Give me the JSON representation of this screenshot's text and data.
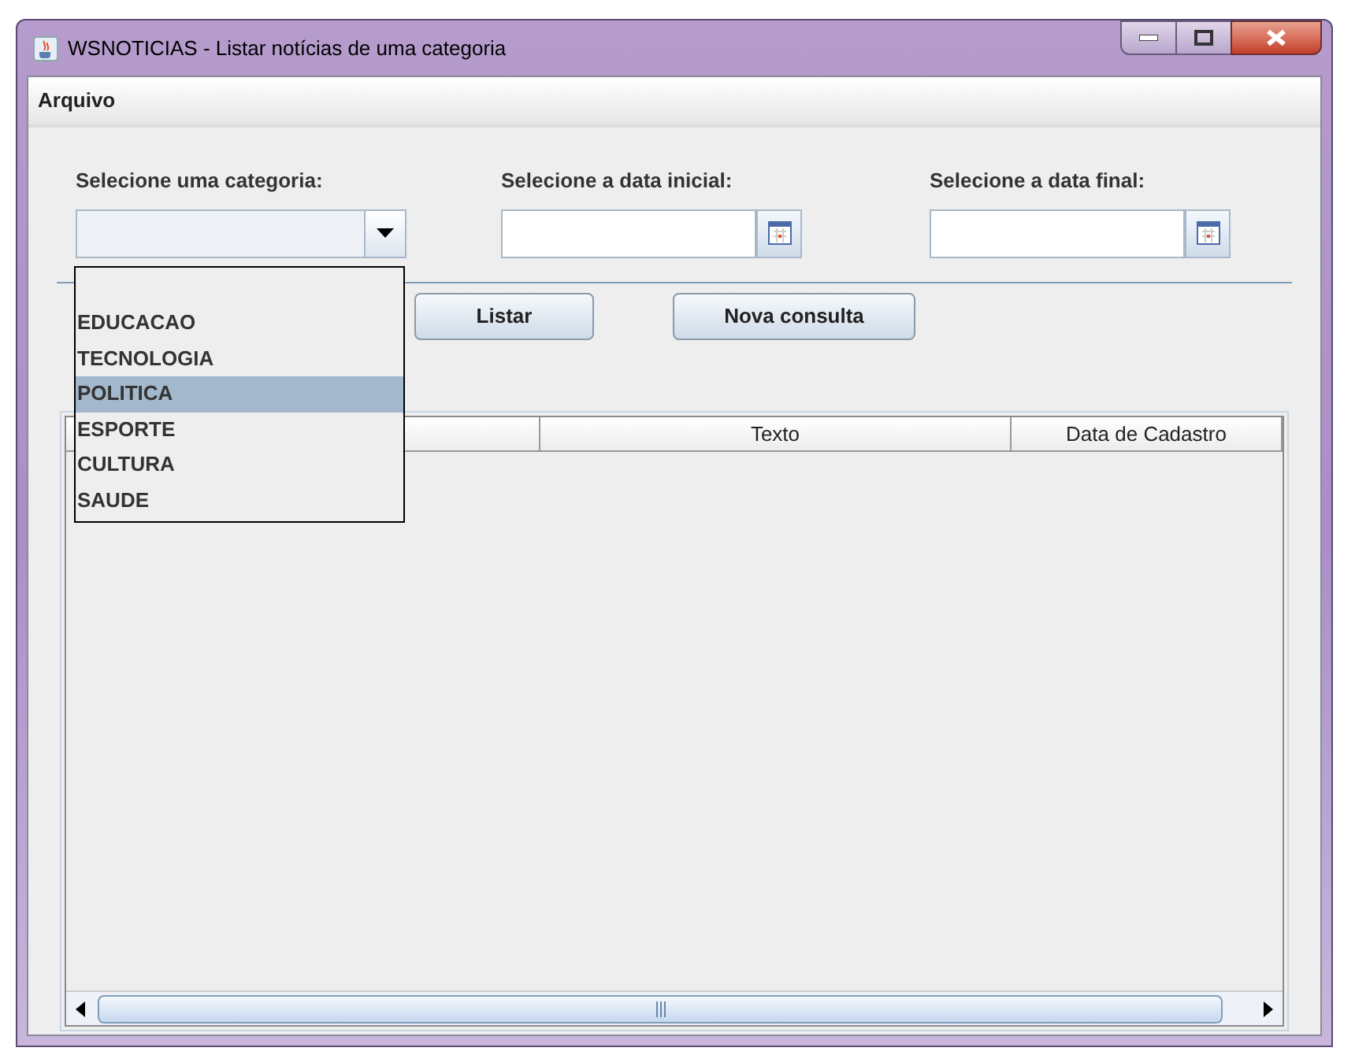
{
  "window": {
    "title": "WSNOTICIAS - Listar notícias de uma categoria"
  },
  "menu": [
    "Arquivo"
  ],
  "filters": [
    {
      "kind": "combo",
      "label": "Selecione uma categoria:"
    },
    {
      "kind": "date",
      "label": "Selecione a data inicial:"
    },
    {
      "kind": "date",
      "label": "Selecione a data final:"
    }
  ],
  "dropdown": {
    "items": [
      {
        "label": "EDUCACAO",
        "selected": false
      },
      {
        "label": "TECNOLOGIA",
        "selected": false
      },
      {
        "label": "POLITICA",
        "selected": true
      },
      {
        "label": "ESPORTE",
        "selected": false
      },
      {
        "label": "CULTURA",
        "selected": false
      },
      {
        "label": "SAUDE",
        "selected": false
      }
    ]
  },
  "buttons": [
    "Listar",
    "Nova consulta"
  ],
  "table": {
    "columns": [
      "Texto",
      "Data de Cadastro"
    ]
  }
}
